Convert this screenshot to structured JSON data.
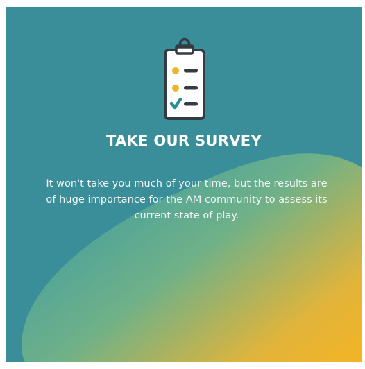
{
  "card": {
    "title": "TAKE OUR SURVEY",
    "body": "It won't take you much of your time, but the results are of huge importance for the AM community to assess its current state of play."
  },
  "icons": {
    "main": "clipboard-checklist-icon"
  },
  "colors": {
    "background_teal": "#3a8e99",
    "gradient_yellow": "#f2b62c",
    "gradient_green": "#7fb47a",
    "icon_dark": "#333b43",
    "icon_light": "#ffffff",
    "bullet_yellow": "#f0b429",
    "check_teal": "#2b8c98",
    "text": "#ffffff"
  }
}
